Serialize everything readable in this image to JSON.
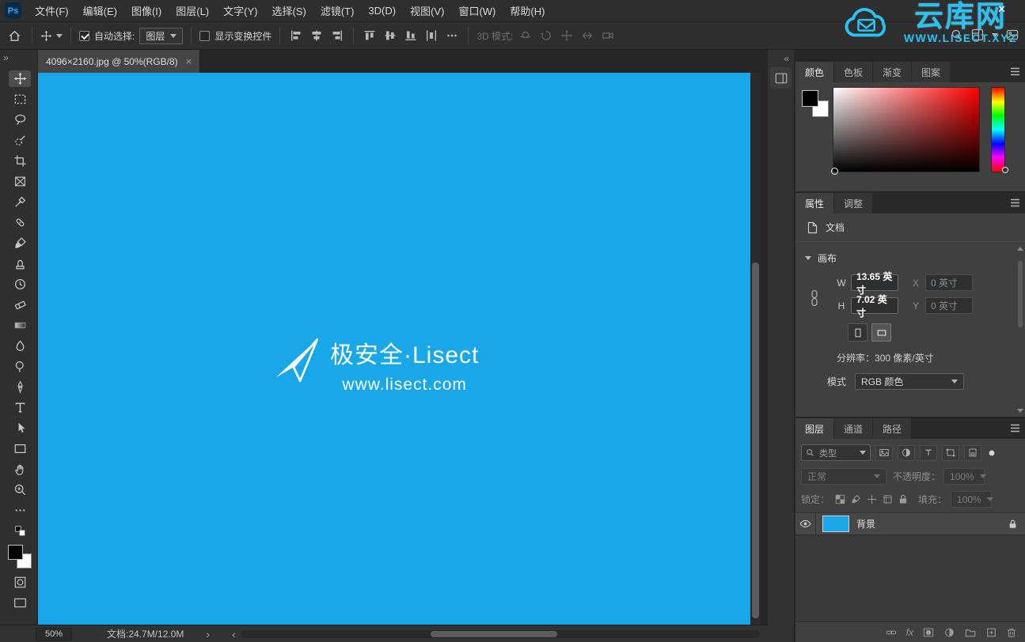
{
  "icons": {
    "collapse_left": "«",
    "collapse_right": "»",
    "nudge_left": "‹",
    "nudge_right": "›",
    "window_close": "✕",
    "tab_close": "×"
  },
  "menu": {
    "logo": "Ps",
    "items": [
      "文件(F)",
      "编辑(E)",
      "图像(I)",
      "图层(L)",
      "文字(Y)",
      "选择(S)",
      "滤镜(T)",
      "3D(D)",
      "视图(V)",
      "窗口(W)",
      "帮助(H)"
    ]
  },
  "options": {
    "auto_select_label": "自动选择:",
    "auto_select_value": "图层",
    "show_transform_label": "显示变换控件",
    "mode3d_label": "3D 模式:"
  },
  "document_tab": {
    "title": "4096×2160.jpg @ 50%(RGB/8)"
  },
  "canvas": {
    "background_color": "#18a7e9",
    "brand": "极安全·Lisect",
    "website": "www.lisect.com"
  },
  "watermark": {
    "name": "云库网",
    "site": "WWW.LISECT.XYZ",
    "color": "#29c2f5"
  },
  "color_panel": {
    "tabs": [
      "颜色",
      "色板",
      "渐变",
      "图案"
    ]
  },
  "properties_panel": {
    "tabs": [
      "属性",
      "调整"
    ],
    "document_label": "文档",
    "canvas_section_label": "画布",
    "w_label": "W",
    "w_value": "13.65 英寸",
    "x_label": "X",
    "x_value": "0 英寸",
    "h_label": "H",
    "h_value": "7.02 英寸",
    "y_label": "Y",
    "y_value": "0 英寸",
    "resolution_label": "分辨率：",
    "resolution_value": "300 像素/英寸",
    "mode_label": "模式",
    "mode_value": "RGB 颜色"
  },
  "layers_panel": {
    "tabs": [
      "图层",
      "通道",
      "路径"
    ],
    "filter_label": "类型",
    "blend_mode": "正常",
    "opacity_label": "不透明度：",
    "opacity_value": "100%",
    "lock_label": "锁定：",
    "fill_label": "填充：",
    "fill_value": "100%",
    "layer_name": "背景",
    "fx_label": "fx"
  },
  "status_bar": {
    "zoom": "50%",
    "doc_info": "文档:24.7M/12.0M"
  }
}
